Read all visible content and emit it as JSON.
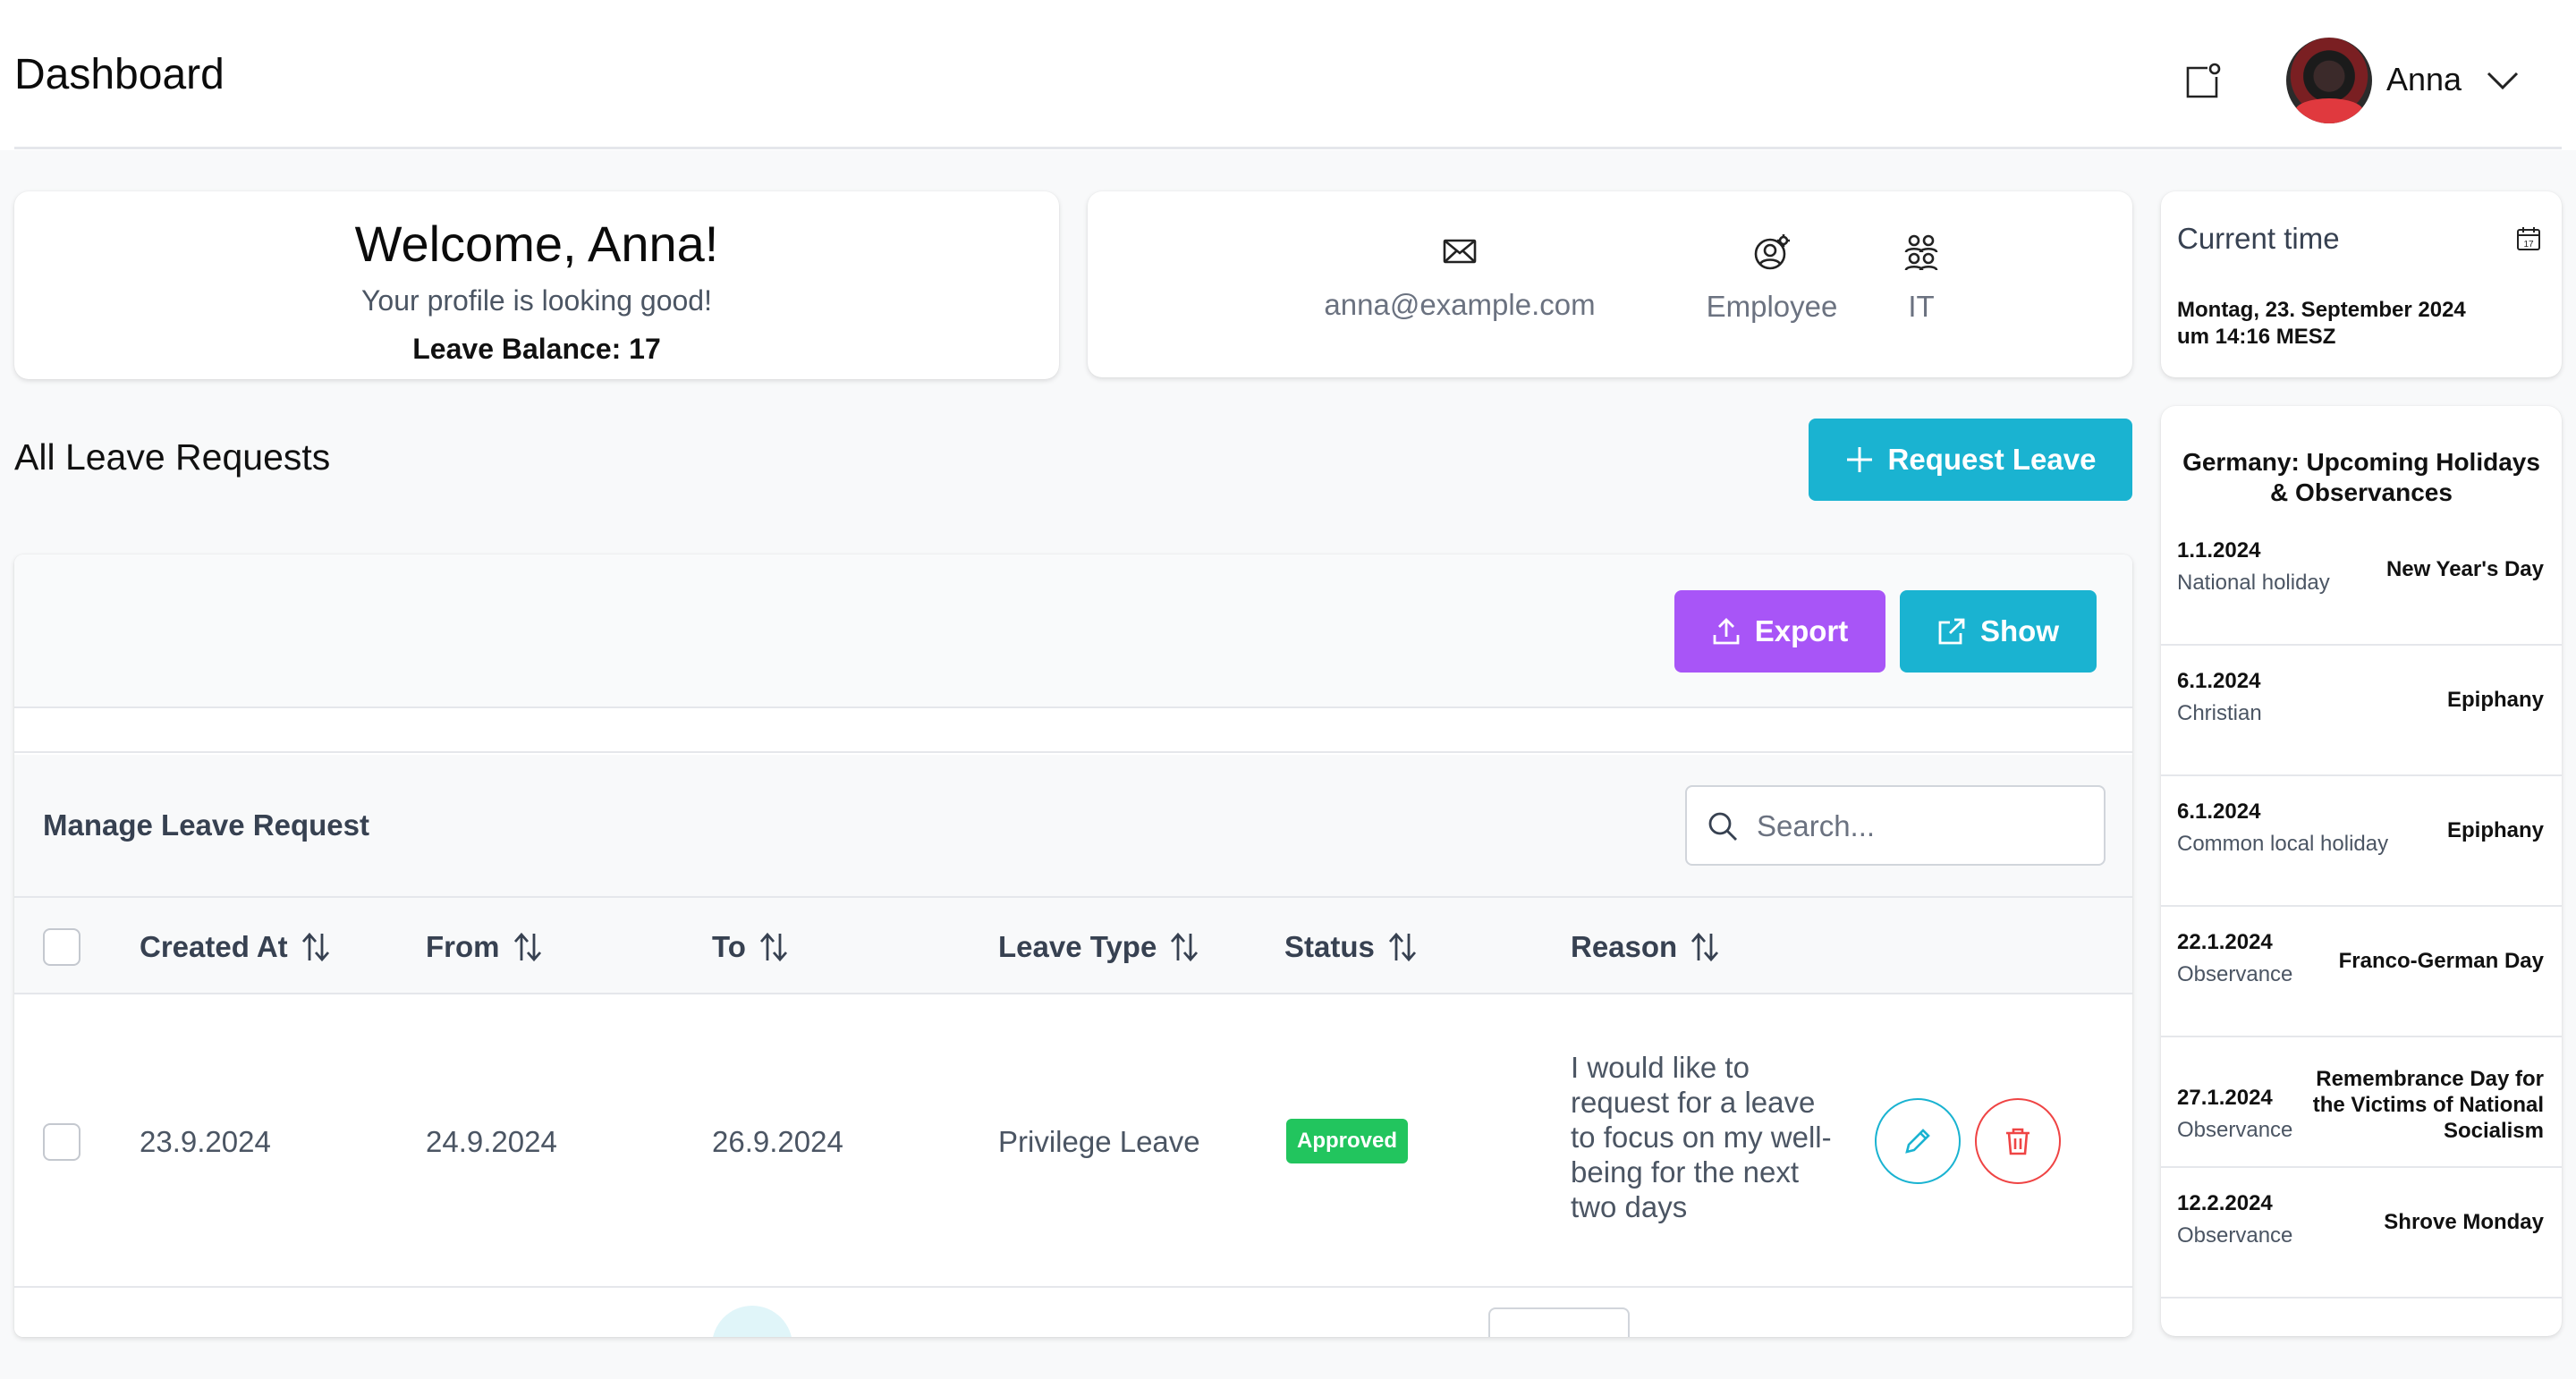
{
  "header": {
    "title": "Dashboard",
    "user_name": "Anna"
  },
  "welcome": {
    "heading": "Welcome, Anna!",
    "subtitle": "Your profile is looking good!",
    "leave_balance": "Leave Balance: 17"
  },
  "profile": {
    "email": "anna@example.com",
    "role": "Employee",
    "department": "IT"
  },
  "time_card": {
    "label": "Current time",
    "value_line1": "Montag, 23. September 2024",
    "value_line2": "um 14:16 MESZ"
  },
  "leave": {
    "section_title": "All Leave Requests",
    "request_button": "Request Leave",
    "export_button": "Export",
    "show_button": "Show",
    "manage_title": "Manage Leave Request",
    "search_placeholder": "Search...",
    "columns": [
      "Created At",
      "From",
      "To",
      "Leave Type",
      "Status",
      "Reason"
    ],
    "rows": [
      {
        "created_at": "23.9.2024",
        "from": "24.9.2024",
        "to": "26.9.2024",
        "leave_type": "Privilege Leave",
        "status": "Approved",
        "reason": "I would like to request for a leave to focus on my well-being for the next two days"
      }
    ]
  },
  "holidays": {
    "title": "Germany: Upcoming Holidays & Observances",
    "items": [
      {
        "date": "1.1.2024",
        "kind": "National holiday",
        "name": "New Year's Day"
      },
      {
        "date": "6.1.2024",
        "kind": "Christian",
        "name": "Epiphany"
      },
      {
        "date": "6.1.2024",
        "kind": "Common local holiday",
        "name": "Epiphany"
      },
      {
        "date": "22.1.2024",
        "kind": "Observance",
        "name": "Franco-German Day"
      },
      {
        "date": "27.1.2024",
        "kind": "Observance",
        "name": "Remembrance Day for the Victims of National Socialism"
      },
      {
        "date": "12.2.2024",
        "kind": "Observance",
        "name": "Shrove Monday"
      }
    ]
  },
  "colors": {
    "accent_cyan": "#1ab3d1",
    "accent_purple": "#a855f7",
    "status_approved": "#22c55e",
    "delete_red": "#ef4444"
  }
}
